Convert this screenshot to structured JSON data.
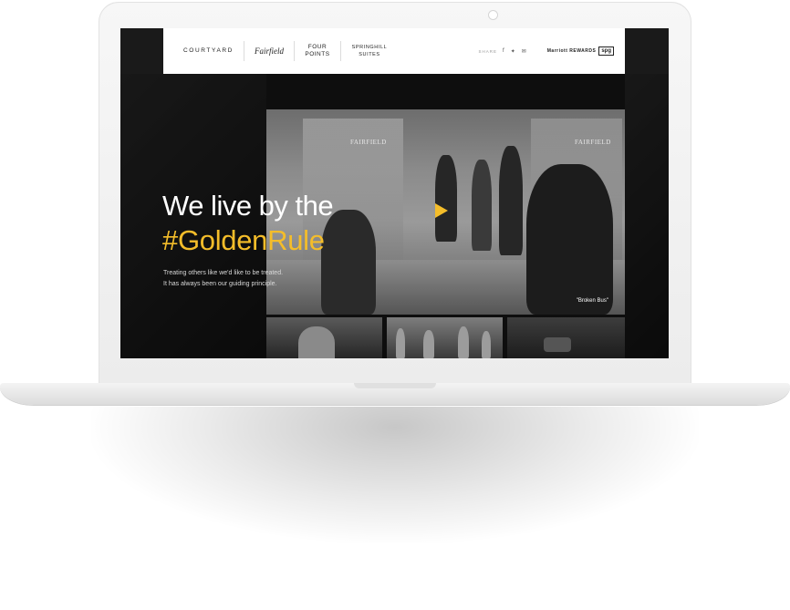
{
  "header": {
    "brands": [
      {
        "label": "COURTYARD"
      },
      {
        "label": "Fairfield"
      },
      {
        "label": "FOUR POINTS"
      },
      {
        "label": "SPRINGHILL SUITES"
      }
    ],
    "share_label": "SHARE",
    "share_icons": [
      "facebook-icon",
      "twitter-icon",
      "email-icon"
    ],
    "rewards_label": "Marriott REWARDS",
    "spg_label": "spg"
  },
  "hero": {
    "title": "We live by the",
    "hashtag": "#GoldenRule",
    "body_line1": "Treating others like we'd like to be treated.",
    "body_line2": "It has always been our guiding principle."
  },
  "video": {
    "caption": "\"Broken Bus\"",
    "sign_left": "FAIRFIELD",
    "sign_right": "FAIRFIELD",
    "play_color": "#f4bd2a"
  },
  "colors": {
    "accent": "#f4bd2a",
    "screen_bg": "#1a1a1a",
    "header_bg": "#ffffff"
  }
}
